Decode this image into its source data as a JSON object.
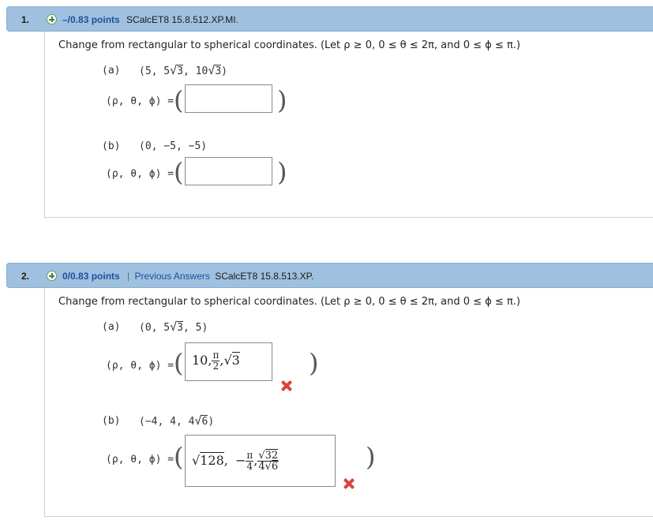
{
  "questions": [
    {
      "number": "1.",
      "points": "–/0.83 points",
      "source": "SCalcET8 15.8.512.XP.MI.",
      "prompt": "Change from rectangular to spherical coordinates. (Let ρ ≥ 0, 0 ≤ θ ≤ 2π, and 0 ≤ ϕ ≤ π.)",
      "parts": [
        {
          "label": "(a)",
          "point": "(5, 5√3, 10√3)",
          "point_prefix": "(5, 5",
          "point_mid": ", 10",
          "point_end": ")",
          "sqrt1": "3",
          "sqrt2": "3",
          "eq": "(ρ, θ, ϕ) =",
          "answer": ""
        },
        {
          "label": "(b)",
          "point": "(0, −5, −5)",
          "eq": "(ρ, θ, ϕ) =",
          "answer": ""
        }
      ]
    },
    {
      "number": "2.",
      "points": "0/0.83 points",
      "separator": "|",
      "previous_answers": "Previous Answers",
      "source": "SCalcET8 15.8.513.XP.",
      "prompt": "Change from rectangular to spherical coordinates. (Let ρ ≥ 0, 0 ≤ θ ≤ 2π, and 0 ≤ ϕ ≤ π.)",
      "parts": [
        {
          "label": "(a)",
          "point_prefix": "(0, 5",
          "sqrt1": "3",
          "point_end": ", 5)",
          "eq": "(ρ, θ, ϕ) =",
          "answer": {
            "a": "10,",
            "frac_num": "π",
            "frac_den": "2",
            "comma": ",",
            "sqrt": "3"
          },
          "status": "incorrect"
        },
        {
          "label": "(b)",
          "point_prefix": "(−4, 4, 4",
          "sqrt1": "6",
          "point_end": ")",
          "eq": "(ρ, θ, ϕ) =",
          "answer": {
            "sqrt_a": "128",
            "comma1": ",",
            "minus": "−",
            "frac_num": "π",
            "frac_den": "4",
            "comma2": ",",
            "sqrt_num": "32",
            "den_coef": "4",
            "sqrt_den": "6"
          },
          "status": "incorrect"
        }
      ]
    }
  ]
}
